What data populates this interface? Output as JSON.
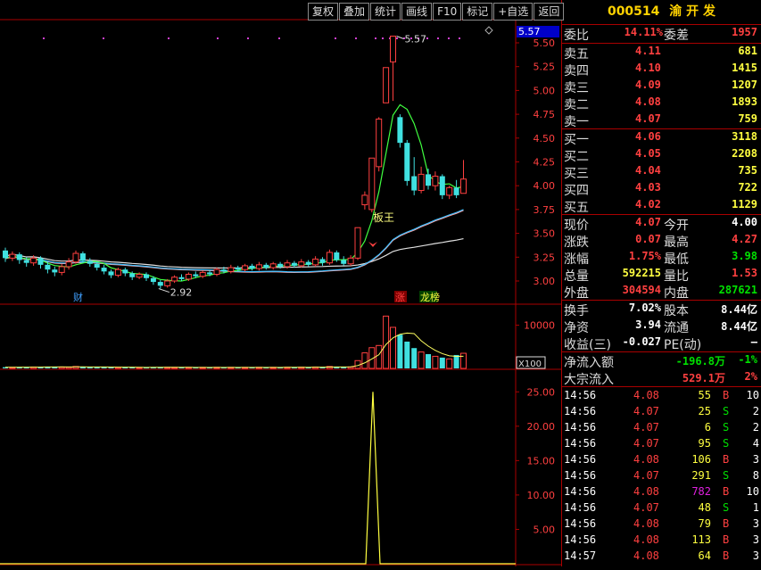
{
  "toolbar": [
    "复权",
    "叠加",
    "统计",
    "画线",
    "F10",
    "标记",
    "+自选",
    "返回"
  ],
  "chart": {
    "price_axis": [
      "5.50",
      "5.25",
      "5.00",
      "4.75",
      "4.50",
      "4.25",
      "4.00",
      "3.75",
      "3.50",
      "3.25",
      "3.00"
    ],
    "price_box": "5.57",
    "high_label": "5.57",
    "low_label": "2.92",
    "label_bang": "板王",
    "label_cai": "财",
    "label_zhang": "涨",
    "label_longhu": "龙榜",
    "volume_axis": "10000",
    "volume_unit": "X100",
    "ind_axis": [
      "25.00",
      "20.00",
      "15.00",
      "10.00",
      "5.00"
    ]
  },
  "chart_data": {
    "type": "candlestick",
    "ylim": [
      2.85,
      5.65
    ],
    "candles": [
      {
        "o": 3.32,
        "c": 3.24,
        "h": 3.35,
        "l": 3.2,
        "v": 280
      },
      {
        "o": 3.24,
        "c": 3.28,
        "h": 3.31,
        "l": 3.21,
        "v": 250
      },
      {
        "o": 3.28,
        "c": 3.22,
        "h": 3.3,
        "l": 3.18,
        "v": 300
      },
      {
        "o": 3.22,
        "c": 3.19,
        "h": 3.25,
        "l": 3.15,
        "v": 270
      },
      {
        "o": 3.19,
        "c": 3.24,
        "h": 3.27,
        "l": 3.16,
        "v": 320
      },
      {
        "o": 3.24,
        "c": 3.17,
        "h": 3.26,
        "l": 3.13,
        "v": 350
      },
      {
        "o": 3.17,
        "c": 3.12,
        "h": 3.2,
        "l": 3.08,
        "v": 420
      },
      {
        "o": 3.12,
        "c": 3.09,
        "h": 3.15,
        "l": 3.05,
        "v": 380
      },
      {
        "o": 3.09,
        "c": 3.15,
        "h": 3.18,
        "l": 3.06,
        "v": 300
      },
      {
        "o": 3.15,
        "c": 3.2,
        "h": 3.24,
        "l": 3.12,
        "v": 290
      },
      {
        "o": 3.2,
        "c": 3.29,
        "h": 3.32,
        "l": 3.18,
        "v": 450
      },
      {
        "o": 3.29,
        "c": 3.21,
        "h": 3.31,
        "l": 3.19,
        "v": 400
      },
      {
        "o": 3.21,
        "c": 3.18,
        "h": 3.24,
        "l": 3.15,
        "v": 280
      },
      {
        "o": 3.18,
        "c": 3.14,
        "h": 3.2,
        "l": 3.11,
        "v": 260
      },
      {
        "o": 3.14,
        "c": 3.1,
        "h": 3.17,
        "l": 3.07,
        "v": 300
      },
      {
        "o": 3.1,
        "c": 3.06,
        "h": 3.12,
        "l": 3.03,
        "v": 340
      },
      {
        "o": 3.06,
        "c": 3.12,
        "h": 3.14,
        "l": 3.04,
        "v": 250
      },
      {
        "o": 3.12,
        "c": 3.08,
        "h": 3.14,
        "l": 3.05,
        "v": 230
      },
      {
        "o": 3.08,
        "c": 3.04,
        "h": 3.1,
        "l": 3.01,
        "v": 270
      },
      {
        "o": 3.04,
        "c": 3.07,
        "h": 3.09,
        "l": 3.02,
        "v": 220
      },
      {
        "o": 3.07,
        "c": 3.03,
        "h": 3.09,
        "l": 3.0,
        "v": 240
      },
      {
        "o": 3.03,
        "c": 2.99,
        "h": 3.05,
        "l": 2.96,
        "v": 280
      },
      {
        "o": 2.99,
        "c": 2.95,
        "h": 3.01,
        "l": 2.92,
        "v": 320
      },
      {
        "o": 2.95,
        "c": 3.0,
        "h": 3.02,
        "l": 2.93,
        "v": 260
      },
      {
        "o": 3.0,
        "c": 3.04,
        "h": 3.06,
        "l": 2.98,
        "v": 240
      },
      {
        "o": 3.04,
        "c": 3.02,
        "h": 3.07,
        "l": 3.0,
        "v": 230
      },
      {
        "o": 3.02,
        "c": 3.07,
        "h": 3.09,
        "l": 3.0,
        "v": 250
      },
      {
        "o": 3.07,
        "c": 3.05,
        "h": 3.1,
        "l": 3.03,
        "v": 220
      },
      {
        "o": 3.05,
        "c": 3.09,
        "h": 3.11,
        "l": 3.03,
        "v": 240
      },
      {
        "o": 3.09,
        "c": 3.07,
        "h": 3.12,
        "l": 3.05,
        "v": 210
      },
      {
        "o": 3.07,
        "c": 3.12,
        "h": 3.14,
        "l": 3.05,
        "v": 260
      },
      {
        "o": 3.12,
        "c": 3.1,
        "h": 3.15,
        "l": 3.08,
        "v": 230
      },
      {
        "o": 3.1,
        "c": 3.14,
        "h": 3.17,
        "l": 3.08,
        "v": 250
      },
      {
        "o": 3.14,
        "c": 3.12,
        "h": 3.16,
        "l": 3.1,
        "v": 220
      },
      {
        "o": 3.12,
        "c": 3.16,
        "h": 3.18,
        "l": 3.1,
        "v": 240
      },
      {
        "o": 3.16,
        "c": 3.13,
        "h": 3.18,
        "l": 3.11,
        "v": 230
      },
      {
        "o": 3.13,
        "c": 3.17,
        "h": 3.2,
        "l": 3.11,
        "v": 260
      },
      {
        "o": 3.17,
        "c": 3.14,
        "h": 3.19,
        "l": 3.12,
        "v": 240
      },
      {
        "o": 3.14,
        "c": 3.18,
        "h": 3.2,
        "l": 3.12,
        "v": 250
      },
      {
        "o": 3.18,
        "c": 3.15,
        "h": 3.2,
        "l": 3.13,
        "v": 230
      },
      {
        "o": 3.15,
        "c": 3.19,
        "h": 3.22,
        "l": 3.13,
        "v": 270
      },
      {
        "o": 3.19,
        "c": 3.16,
        "h": 3.21,
        "l": 3.14,
        "v": 240
      },
      {
        "o": 3.16,
        "c": 3.2,
        "h": 3.23,
        "l": 3.14,
        "v": 290
      },
      {
        "o": 3.2,
        "c": 3.17,
        "h": 3.22,
        "l": 3.15,
        "v": 250
      },
      {
        "o": 3.17,
        "c": 3.23,
        "h": 3.26,
        "l": 3.15,
        "v": 320
      },
      {
        "o": 3.23,
        "c": 3.19,
        "h": 3.25,
        "l": 3.16,
        "v": 280
      },
      {
        "o": 3.19,
        "c": 3.3,
        "h": 3.33,
        "l": 3.17,
        "v": 450
      },
      {
        "o": 3.3,
        "c": 3.22,
        "h": 3.32,
        "l": 3.2,
        "v": 380
      },
      {
        "o": 3.22,
        "c": 3.18,
        "h": 3.26,
        "l": 3.16,
        "v": 300
      },
      {
        "o": 3.18,
        "c": 3.24,
        "h": 3.27,
        "l": 3.16,
        "v": 350
      },
      {
        "o": 3.24,
        "c": 3.56,
        "h": 3.56,
        "l": 3.22,
        "v": 1800
      },
      {
        "o": 3.8,
        "c": 3.9,
        "h": 3.94,
        "l": 3.75,
        "v": 3600
      },
      {
        "o": 3.75,
        "c": 4.29,
        "h": 4.29,
        "l": 3.72,
        "v": 4800
      },
      {
        "o": 4.2,
        "c": 4.7,
        "h": 4.72,
        "l": 4.15,
        "v": 5300
      },
      {
        "o": 4.87,
        "c": 5.24,
        "h": 5.24,
        "l": 4.87,
        "v": 12100
      },
      {
        "o": 5.3,
        "c": 5.57,
        "h": 5.57,
        "l": 4.89,
        "v": 9500
      },
      {
        "o": 4.72,
        "c": 4.45,
        "h": 4.75,
        "l": 4.4,
        "v": 7800
      },
      {
        "o": 4.45,
        "c": 4.05,
        "h": 4.48,
        "l": 4.0,
        "v": 6200
      },
      {
        "o": 4.1,
        "c": 3.95,
        "h": 4.3,
        "l": 3.9,
        "v": 4700
      },
      {
        "o": 3.95,
        "c": 4.12,
        "h": 4.2,
        "l": 3.92,
        "v": 3800
      },
      {
        "o": 4.12,
        "c": 4.0,
        "h": 4.18,
        "l": 3.96,
        "v": 3300
      },
      {
        "o": 4.0,
        "c": 4.1,
        "h": 4.15,
        "l": 3.95,
        "v": 2800
      },
      {
        "o": 4.1,
        "c": 3.9,
        "h": 4.12,
        "l": 3.86,
        "v": 2500
      },
      {
        "o": 3.9,
        "c": 3.98,
        "h": 4.0,
        "l": 3.86,
        "v": 2200
      },
      {
        "o": 3.98,
        "c": 3.9,
        "h": 4.06,
        "l": 3.87,
        "v": 3100
      },
      {
        "o": 3.92,
        "c": 4.07,
        "h": 4.27,
        "l": 3.98,
        "v": 3500
      }
    ]
  },
  "stock": {
    "code": "000514",
    "name": "渝 开 发"
  },
  "weibi": {
    "label": "委比",
    "value": "14.11%",
    "cha_label": "委差",
    "cha": "1957"
  },
  "asks": [
    {
      "label": "卖五",
      "price": "4.11",
      "vol": "681"
    },
    {
      "label": "卖四",
      "price": "4.10",
      "vol": "1415"
    },
    {
      "label": "卖三",
      "price": "4.09",
      "vol": "1207"
    },
    {
      "label": "卖二",
      "price": "4.08",
      "vol": "1893"
    },
    {
      "label": "卖一",
      "price": "4.07",
      "vol": "759"
    }
  ],
  "bids": [
    {
      "label": "买一",
      "price": "4.06",
      "vol": "3118"
    },
    {
      "label": "买二",
      "price": "4.05",
      "vol": "2208"
    },
    {
      "label": "买三",
      "price": "4.04",
      "vol": "735"
    },
    {
      "label": "买四",
      "price": "4.03",
      "vol": "722"
    },
    {
      "label": "买五",
      "price": "4.02",
      "vol": "1129"
    }
  ],
  "quote": [
    {
      "l1": "现价",
      "v1": "4.07",
      "l2": "今开",
      "v2": "4.00"
    },
    {
      "l1": "涨跌",
      "v1": "0.07",
      "l2": "最高",
      "v2": "4.27"
    },
    {
      "l1": "涨幅",
      "v1": "1.75%",
      "l2": "最低",
      "v2": "3.98"
    },
    {
      "l1": "总量",
      "v1": "592215",
      "l2": "量比",
      "v2": "1.53"
    },
    {
      "l1": "外盘",
      "v1": "304594",
      "l2": "内盘",
      "v2": "287621"
    }
  ],
  "fin": [
    {
      "l1": "换手",
      "v1": "7.02%",
      "l2": "股本",
      "v2": "8.44亿"
    },
    {
      "l1": "净资",
      "v1": "3.94",
      "l2": "流通",
      "v2": "8.44亿"
    },
    {
      "l1": "收益(三)",
      "v1": "-0.027",
      "l2": "PE(动)",
      "v2": "–"
    }
  ],
  "flow": [
    {
      "label": "净流入额",
      "value": "-196.8万",
      "pct": "-1%"
    },
    {
      "label": "大宗流入",
      "value": "529.1万",
      "pct": "2%"
    }
  ],
  "ticks": [
    {
      "t": "14:56",
      "p": "4.08",
      "v": "55",
      "d": "B",
      "n": "10"
    },
    {
      "t": "14:56",
      "p": "4.07",
      "v": "25",
      "d": "S",
      "n": "2"
    },
    {
      "t": "14:56",
      "p": "4.07",
      "v": "6",
      "d": "S",
      "n": "2"
    },
    {
      "t": "14:56",
      "p": "4.07",
      "v": "95",
      "d": "S",
      "n": "4"
    },
    {
      "t": "14:56",
      "p": "4.08",
      "v": "106",
      "d": "B",
      "n": "3"
    },
    {
      "t": "14:56",
      "p": "4.07",
      "v": "291",
      "d": "S",
      "n": "8"
    },
    {
      "t": "14:56",
      "p": "4.08",
      "v": "782",
      "d": "B",
      "n": "10"
    },
    {
      "t": "14:56",
      "p": "4.07",
      "v": "48",
      "d": "S",
      "n": "1"
    },
    {
      "t": "14:56",
      "p": "4.08",
      "v": "79",
      "d": "B",
      "n": "3"
    },
    {
      "t": "14:56",
      "p": "4.08",
      "v": "113",
      "d": "B",
      "n": "3"
    },
    {
      "t": "14:57",
      "p": "4.08",
      "v": "64",
      "d": "B",
      "n": "3"
    }
  ]
}
